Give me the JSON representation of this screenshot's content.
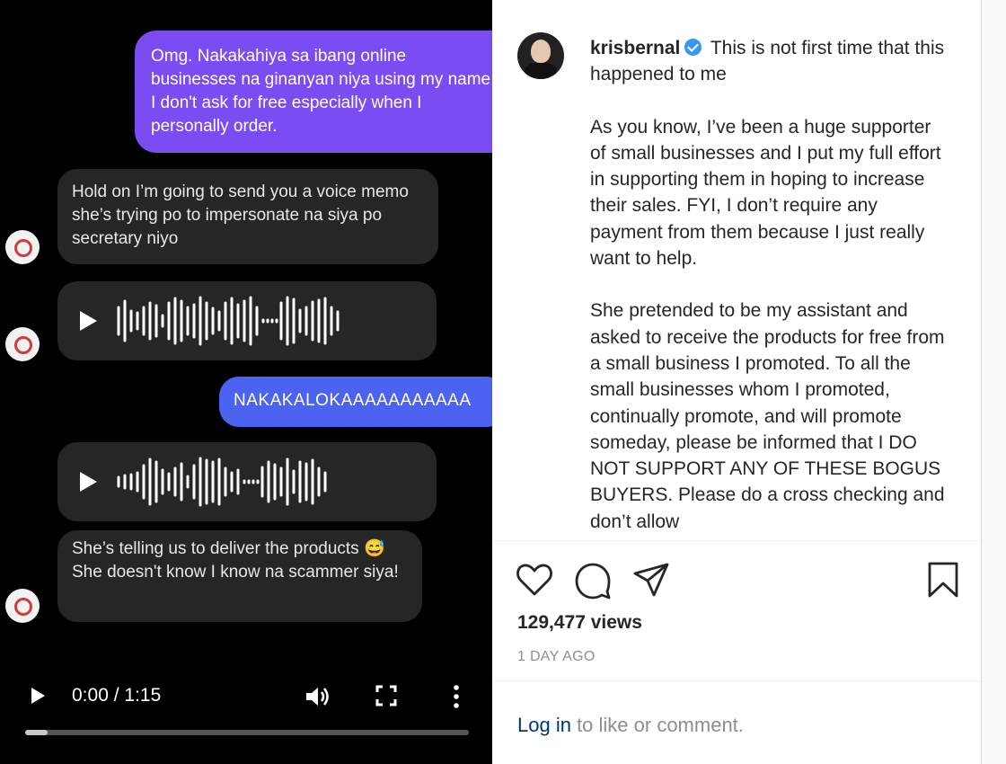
{
  "video": {
    "messages": {
      "m1": "Omg. Nakakahiya sa ibang online businesses na ginanyan niya using my name. I don't ask for free especially when I personally order.",
      "m2": "Hold on I’m going to send you a voice memo she’s trying po to impersonate na siya po secretary niyo",
      "m3": "NAKAKALOKAAAAAAAAAAA",
      "m4a": "She’s telling us to deliver the products ",
      "m4emoji": "😅",
      "m4b": " She doesn't know I know na scammer siya!"
    },
    "controls": {
      "time": "0:00 / 1:15",
      "progress": 0.05
    },
    "colors": {
      "outgoing": "#7a4cf2",
      "outgoing_alt": "#4b63f0",
      "incoming": "#262626"
    },
    "icons": [
      "play-icon",
      "waveform-icon",
      "volume-icon",
      "fullscreen-icon",
      "more-icon"
    ]
  },
  "post": {
    "username": "krisbernal",
    "caption_first": "This is not first time that this happened to me",
    "para2": "As you know, I’ve been a huge supporter of small businesses and I put my full effort in supporting them in hoping to increase their sales. FYI, I don’t require any payment from them because I just really want to help.",
    "para3": "She pretended to be my assistant and asked to receive the products for free from a small business I promoted. To all the small businesses whom I promoted, continually promote, and will promote someday, please be informed that I DO NOT SUPPORT ANY OF THESE BOGUS BUYERS. Please do a cross checking and don’t allow",
    "views": "129,477 views",
    "date": "1 DAY AGO",
    "login_link": "Log in",
    "login_rest": " to like or comment.",
    "colors": {
      "verified": "#3897f0",
      "link": "#00376b",
      "muted": "#8e8e8e"
    },
    "icons": [
      "heart-icon",
      "comment-icon",
      "share-icon",
      "bookmark-icon",
      "verified-icon"
    ]
  }
}
